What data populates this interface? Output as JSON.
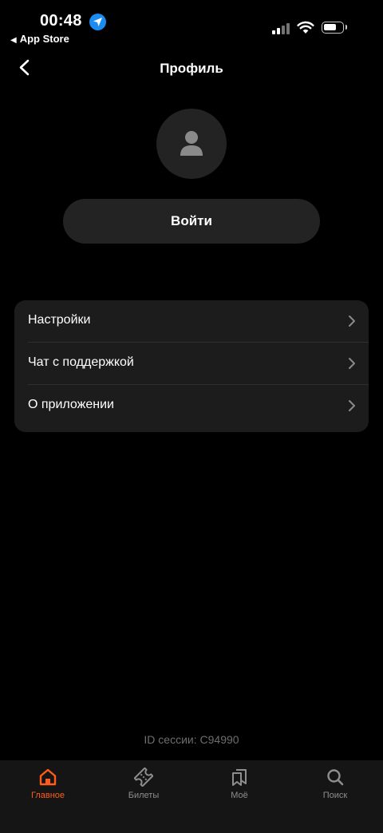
{
  "status_bar": {
    "time": "00:48",
    "back_app": "App Store",
    "back_arrow": "◀"
  },
  "header": {
    "title": "Профиль",
    "back_icon": "chevron-left-icon"
  },
  "avatar_icon": "person-icon",
  "login": {
    "label": "Войти"
  },
  "menu": {
    "items": [
      {
        "label": "Настройки",
        "icon": "chevron-right-icon"
      },
      {
        "label": "Чат с поддержкой",
        "icon": "chevron-right-icon"
      },
      {
        "label": "О приложении",
        "icon": "chevron-right-icon"
      }
    ]
  },
  "session": {
    "text": "ID сессии: C94990"
  },
  "tab_bar": {
    "accent_color": "#ff5c1a",
    "tabs": [
      {
        "label": "Главное",
        "icon": "home-icon",
        "active": true
      },
      {
        "label": "Билеты",
        "icon": "ticket-icon",
        "active": false
      },
      {
        "label": "Моё",
        "icon": "bookmarks-icon",
        "active": false
      },
      {
        "label": "Поиск",
        "icon": "search-icon",
        "active": false
      }
    ]
  }
}
